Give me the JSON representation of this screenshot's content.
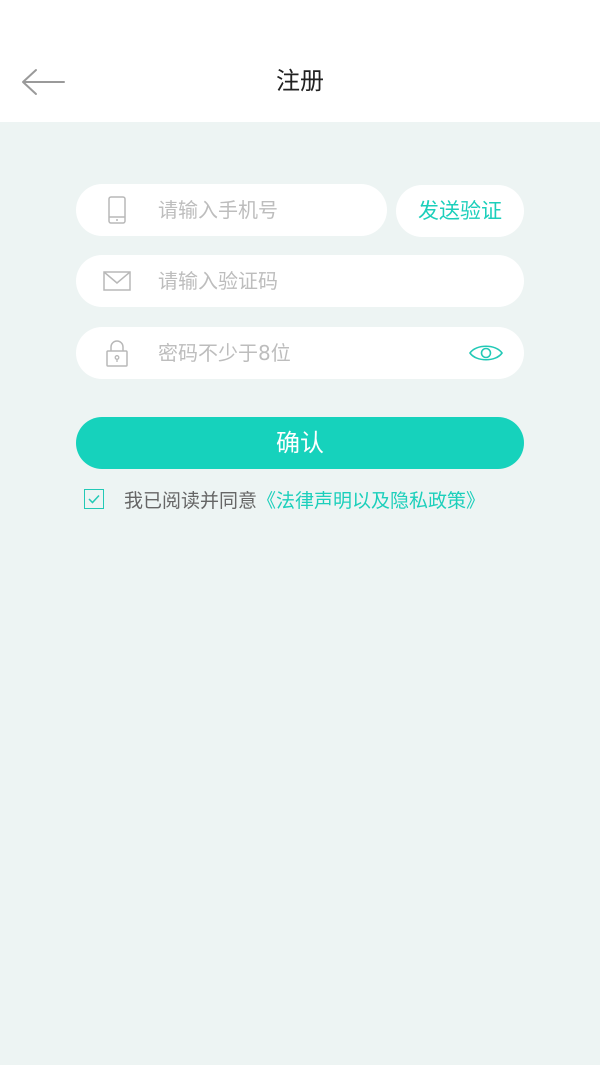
{
  "header": {
    "title": "注册",
    "back_icon": "arrow-left-icon"
  },
  "form": {
    "phone": {
      "placeholder": "请输入手机号",
      "value": "",
      "icon": "phone-icon"
    },
    "send_code_label": "发送验证",
    "code": {
      "placeholder": "请输入验证码",
      "value": "",
      "icon": "mail-icon"
    },
    "password": {
      "placeholder": "密码不少于8位",
      "value": "",
      "icon": "lock-icon",
      "toggle_icon": "eye-icon"
    },
    "confirm_label": "确认"
  },
  "agreement": {
    "checked": true,
    "text": "我已阅读并同意",
    "link": "《法律声明以及隐私政策》"
  },
  "colors": {
    "accent": "#16d2bc",
    "background": "#edf4f3",
    "placeholder": "#bdbdbd"
  }
}
